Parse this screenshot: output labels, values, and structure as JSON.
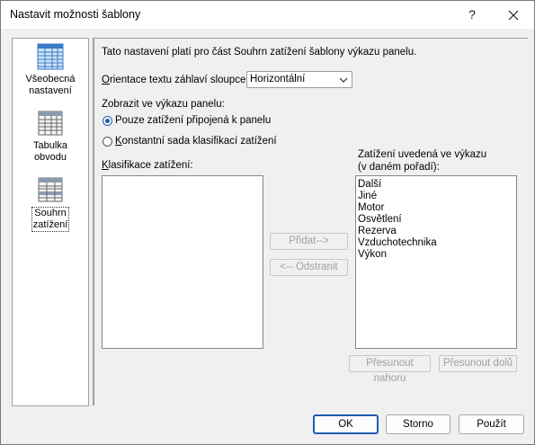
{
  "window": {
    "title": "Nastavit možnosti šablony",
    "help_label": "?",
    "close_label": "✕"
  },
  "nav": {
    "items": [
      {
        "label_line1": "Všeobecná",
        "label_line2": "nastavení",
        "icon": "spreadsheet-icon"
      },
      {
        "label_line1": "Tabulka",
        "label_line2": "obvodu",
        "icon": "table-icon"
      },
      {
        "label_line1": "Souhrn",
        "label_line2": "zatížení",
        "icon": "summary-table-icon",
        "selected": true
      }
    ]
  },
  "main": {
    "description": "Tato nastavení platí pro část Souhrn zatížení šablony výkazu panelu.",
    "orientation_label": "rientace textu záhlaví sloupce:",
    "orientation_label_prefix": "O",
    "orientation_value": "Horizontální",
    "show_label": "Zobrazit ve výkazu panelu:",
    "radio_attached": "Pouze zatížení připojená k panelu",
    "radio_attached_underline": "z",
    "radio_constant": "onstantní sada klasifikací zatížení",
    "radio_constant_underline": "K",
    "classification_label": "lasifikace zatížení:",
    "classification_label_underline": "K",
    "listed_label_line1": "Zatížení uvedená ve výkazu",
    "listed_label_line2": "(v daném pořadí):",
    "listed_items": [
      "Další",
      "Jiné",
      "Motor",
      "Osvětlení",
      "Rezerva",
      "Vzduchotechnika",
      "Výkon"
    ],
    "add_button": "Přidat-->",
    "remove_button": "<-- Odstranit",
    "move_up_button": "Přesunout nahoru",
    "move_down_button": "Přesunout dolů"
  },
  "footer": {
    "ok": "OK",
    "cancel": "Storno",
    "apply": "Použít"
  }
}
